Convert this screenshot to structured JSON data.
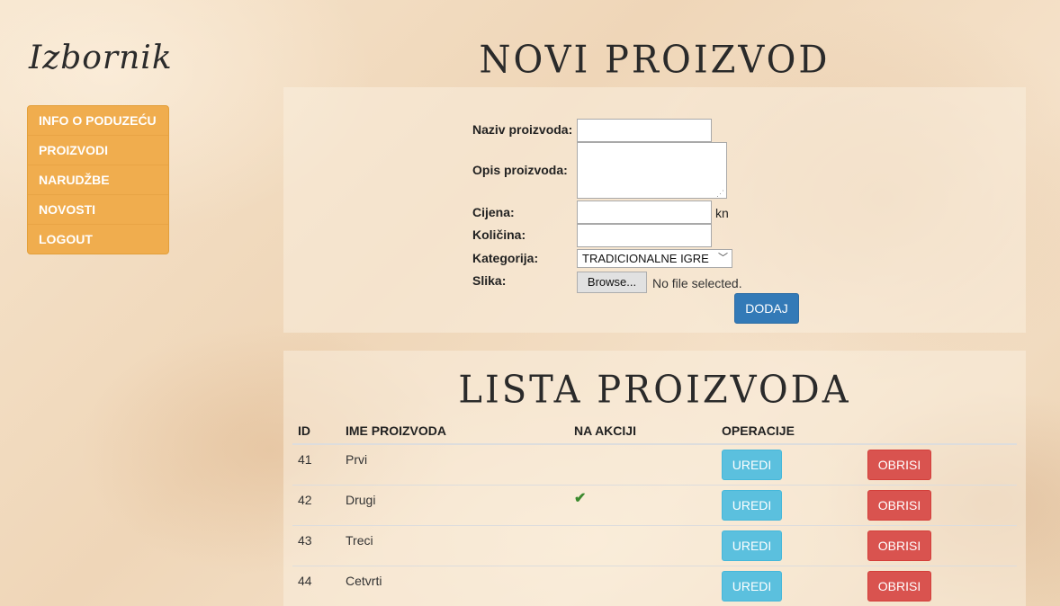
{
  "brand": "Izbornik",
  "menu": [
    "INFO O PODUZEĆU",
    "PROIZVODI",
    "NARUDŽBE",
    "NOVOSTI",
    "LOGOUT"
  ],
  "form": {
    "title": "NOVI PROIZVOD",
    "name_label": "Naziv proizvoda:",
    "name_value": "",
    "desc_label": "Opis proizvoda:",
    "desc_value": "",
    "price_label": "Cijena:",
    "price_value": "",
    "price_unit": "kn",
    "qty_label": "Količina:",
    "qty_value": "",
    "category_label": "Kategorija:",
    "category_selected": "TRADICIONALNE IGRE",
    "image_label": "Slika:",
    "browse_label": "Browse...",
    "file_status": "No file selected.",
    "submit_label": "DODAJ"
  },
  "list": {
    "title": "LISTA PROIZVODA",
    "headers": {
      "id": "ID",
      "name": "IME PROIZVODA",
      "sale": "NA AKCIJI",
      "ops": "OPERACIJE"
    },
    "edit_label": "UREDI",
    "delete_label": "OBRISI",
    "rows": [
      {
        "id": "41",
        "name": "Prvi",
        "on_sale": false
      },
      {
        "id": "42",
        "name": "Drugi",
        "on_sale": true
      },
      {
        "id": "43",
        "name": "Treci",
        "on_sale": false
      },
      {
        "id": "44",
        "name": "Cetvrti",
        "on_sale": false
      }
    ]
  },
  "colors": {
    "menu_bg": "#f0ad4e",
    "primary": "#337ab7",
    "info": "#5bc0de",
    "danger": "#d9534f",
    "check": "#3c8a2e"
  },
  "icons": {
    "on_sale": "check-icon",
    "resize": "resize-grip-icon",
    "select": "chevron-down-icon"
  }
}
